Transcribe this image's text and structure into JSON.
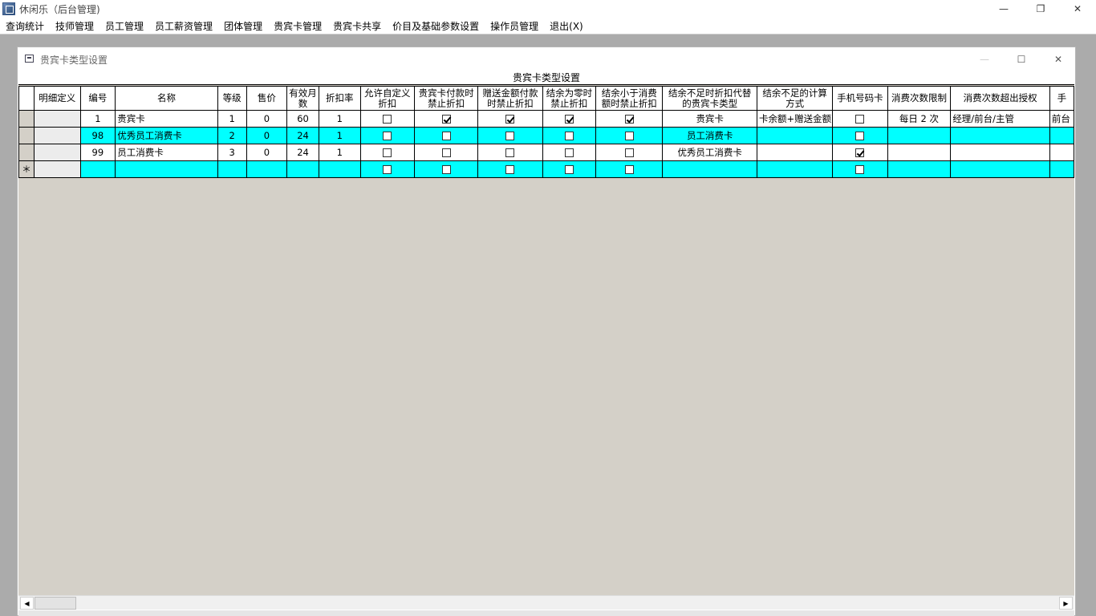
{
  "app": {
    "title": "休闲乐（后台管理)",
    "minimize": "—",
    "restore": "❐",
    "close": "✕"
  },
  "menu": [
    "查询统计",
    "技师管理",
    "员工管理",
    "员工薪资管理",
    "团体管理",
    "贵宾卡管理",
    "贵宾卡共享",
    "价目及基础参数设置",
    "操作员管理",
    "退出(X)"
  ],
  "child_window": {
    "title": "贵宾卡类型设置",
    "minimize": "—",
    "maximize": "☐",
    "close": "✕"
  },
  "grid": {
    "caption": "贵宾卡类型设置",
    "headers": [
      "明细定义",
      "编号",
      "名称",
      "等级",
      "售价",
      "有效月数",
      "折扣率",
      "允许自定义折扣",
      "贵宾卡付款时禁止折扣",
      "赠送金额付款时禁止折扣",
      "结余为零时禁止折扣",
      "结余小于消费额时禁止折扣",
      "结余不足时折扣代替的贵宾卡类型",
      "结余不足的计算方式",
      "手机号码卡",
      "消费次数限制",
      "消费次数超出授权",
      "手"
    ],
    "rows": [
      {
        "style": "white",
        "indicator": "",
        "detail": "",
        "id": "1",
        "name": "贵宾卡",
        "level": "1",
        "price": "0",
        "months": "60",
        "discount": "1",
        "allow_custom": false,
        "vip_pay_forbid": true,
        "gift_pay_forbid": true,
        "zero_forbid": true,
        "less_forbid": true,
        "replace_type": "贵宾卡",
        "calc_method": "卡余额+赠送金额",
        "mobile_card": false,
        "limit": "每日 2 次",
        "authorize": "经理/前台/主管",
        "extra": "前台"
      },
      {
        "style": "cyan",
        "indicator": "",
        "detail": "",
        "id": "98",
        "name": "优秀员工消费卡",
        "level": "2",
        "price": "0",
        "months": "24",
        "discount": "1",
        "allow_custom": false,
        "vip_pay_forbid": false,
        "gift_pay_forbid": false,
        "zero_forbid": false,
        "less_forbid": false,
        "replace_type": "员工消费卡",
        "calc_method": "",
        "mobile_card": false,
        "limit": "",
        "authorize": "",
        "extra": ""
      },
      {
        "style": "white",
        "indicator": "",
        "detail": "",
        "id": "99",
        "name": "员工消费卡",
        "level": "3",
        "price": "0",
        "months": "24",
        "discount": "1",
        "allow_custom": false,
        "vip_pay_forbid": false,
        "gift_pay_forbid": false,
        "zero_forbid": false,
        "less_forbid": false,
        "replace_type": "优秀员工消费卡",
        "calc_method": "",
        "mobile_card": true,
        "limit": "",
        "authorize": "",
        "extra": ""
      },
      {
        "style": "cyan",
        "indicator": "＊",
        "detail": "",
        "id": "",
        "name": "",
        "level": "",
        "price": "",
        "months": "",
        "discount": "",
        "allow_custom": false,
        "vip_pay_forbid": false,
        "gift_pay_forbid": false,
        "zero_forbid": false,
        "less_forbid": false,
        "replace_type": "",
        "calc_method": "",
        "mobile_card": false,
        "limit": "",
        "authorize": "",
        "extra": ""
      }
    ]
  },
  "scrollbar": {
    "left_arrow": "◀",
    "right_arrow": "▶"
  }
}
